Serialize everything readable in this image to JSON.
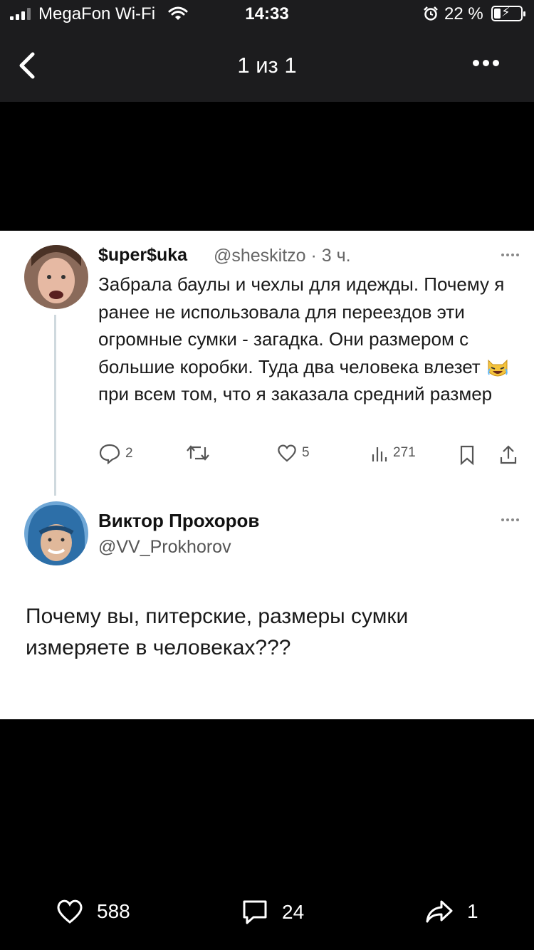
{
  "status_bar": {
    "carrier": "MegaFon Wi-Fi",
    "time": "14:33",
    "battery": "22 %",
    "battery_level": 0.22,
    "icons": [
      "signal-icon",
      "wifi-icon",
      "alarm-icon",
      "battery-icon"
    ]
  },
  "nav": {
    "title": "1 из 1",
    "icons": [
      "chevron-left-icon",
      "more-icon"
    ]
  },
  "tweet": {
    "author_name": "$uper$uka",
    "author_handle": "@sheskitzo · 3 ч.",
    "text_part1": "Забрала баулы и чехлы для идежды. Почему я ранее не использовала для переездов эти огромные сумки - загадка. Они размером с большие коробки. Туда два человека влезет",
    "text_part2": "при всем том, что я заказала средний размер",
    "emoji": "laughing-cat-emoji",
    "replies": "2",
    "likes": "5",
    "views": "271"
  },
  "reply": {
    "author_name": "Виктор Прохоров",
    "author_handle": "@VV_Prokhorov",
    "text": "Почему вы, питерские, размеры сумки измеряете в человеках???"
  },
  "bottom_bar": {
    "likes": "588",
    "comments": "24",
    "shares": "1"
  },
  "colors": {
    "background": "#000000",
    "top_bar": "#1c1c1e",
    "card": "#ffffff",
    "muted": "#666666",
    "thread_line": "#cfd9de"
  }
}
